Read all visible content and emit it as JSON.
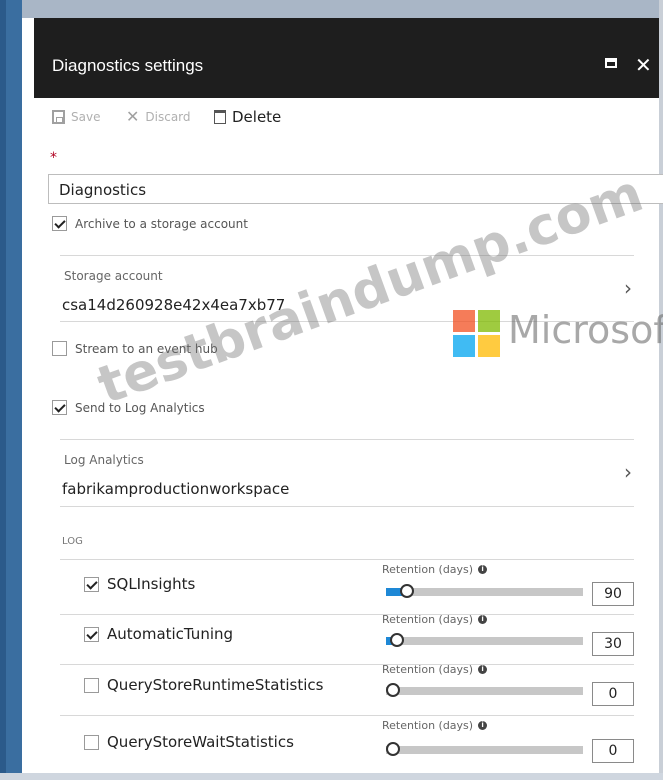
{
  "window": {
    "title": "Diagnostics settings"
  },
  "toolbar": {
    "save_label": "Save",
    "discard_label": "Discard",
    "delete_label": "Delete"
  },
  "form": {
    "required_mark": "*",
    "name_value": "Diagnostics",
    "archive_label": "Archive to a storage account",
    "archive_checked": true,
    "storage_label": "Storage account",
    "storage_value": "csa14d260928e42x4ea7xb77",
    "stream_label": "Stream to an event hub",
    "stream_checked": false,
    "loganalytics_checkbox_label": "Send to Log Analytics",
    "loganalytics_checked": true,
    "loganalytics_label": "Log Analytics",
    "loganalytics_value": "fabrikamproductionworkspace"
  },
  "log": {
    "section_label": "LOG",
    "retention_label": "Retention (days)",
    "items": [
      {
        "name": "SQLInsights",
        "checked": true,
        "retention": "90",
        "fill": 0.09
      },
      {
        "name": "AutomaticTuning",
        "checked": true,
        "retention": "30",
        "fill": 0.04
      },
      {
        "name": "QueryStoreRuntimeStatistics",
        "checked": false,
        "retention": "0",
        "fill": 0
      },
      {
        "name": "QueryStoreWaitStatistics",
        "checked": false,
        "retention": "0",
        "fill": 0
      }
    ]
  },
  "watermark": {
    "site": "testbraindump.com",
    "brand": "Microsoft"
  },
  "colors": {
    "titlebar": "#1e1e1e",
    "accent": "#1e88d6",
    "required": "#b00020"
  }
}
